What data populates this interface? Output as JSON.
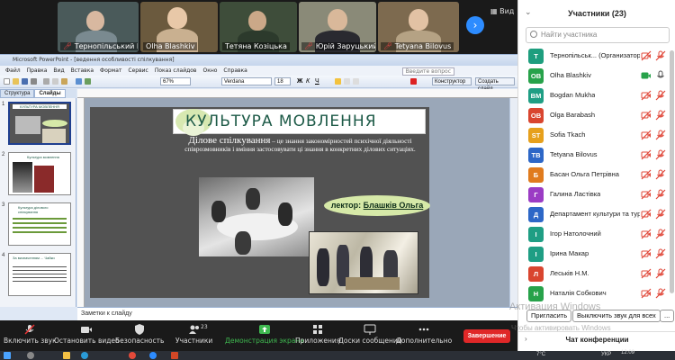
{
  "video_strip": {
    "tiles": [
      {
        "name": "Тернопільський Ц...",
        "bg": "#4a5a5a"
      },
      {
        "name": "Olha Blashkiv",
        "bg": "#6b5a3e"
      },
      {
        "name": "Тетяна Козіцька",
        "bg": "#3e4d3a"
      },
      {
        "name": "Юрій Заруцький",
        "bg": "#8a8a78"
      },
      {
        "name": "Tetyana Bilovus",
        "bg": "#7d6a4f"
      }
    ],
    "view_label": "Вид"
  },
  "ppt": {
    "window_title": "Microsoft PowerPoint - [ведення особливості спілкування]",
    "menu": [
      "Файл",
      "Правка",
      "Вид",
      "Вставка",
      "Формат",
      "Сервис",
      "Показ слайдов",
      "Окно",
      "Справка"
    ],
    "zoom": "67%",
    "font": "Verdana",
    "font_size": "18",
    "search_placeholder": "Введите вопрос",
    "constructor_label": "Конструктор",
    "new_slide_label": "Создать слайд",
    "tabs": [
      "Структура",
      "Слайды"
    ],
    "thumbs": [
      {
        "num": "1",
        "title": "КУЛЬТУРА МОВЛЕННЯ"
      },
      {
        "num": "2",
        "title": "Культура мовлення"
      },
      {
        "num": "3",
        "title": "Культура ділового спілкування"
      },
      {
        "num": "4",
        "title": "За визначенням ... Чайки"
      }
    ],
    "notes_placeholder": "Заметки к слайду"
  },
  "slide": {
    "title": "КУЛЬТУРА МОВЛЕННЯ",
    "body_lead": "Ділове спілкування",
    "body_text": " – це знання закономірностей психічної діяльності співрозмовників і вміння застосовувати ці знання в конкретних ділових ситуаціях.",
    "lector_prefix": "лектор:",
    "lector_name": "Блашків Ольга"
  },
  "panel": {
    "title": "Участники (23)",
    "search_placeholder": "Найти участника",
    "participants": [
      {
        "initials": "Т",
        "name": "Тернопільськ... (Организатор, я)",
        "color": "#1e9e7e",
        "mic": "muted",
        "cam": "off"
      },
      {
        "initials": "OB",
        "name": "Olha Blashkiv",
        "color": "#27a24a",
        "mic": "on",
        "cam": "on"
      },
      {
        "initials": "BM",
        "name": "Bogdan Mukha",
        "color": "#1f9e84",
        "mic": "muted",
        "cam": "off"
      },
      {
        "initials": "OB",
        "name": "Olga Barabash",
        "color": "#d9452f",
        "mic": "muted",
        "cam": "off"
      },
      {
        "initials": "ST",
        "name": "Sofia Tkach",
        "color": "#e6a01c",
        "mic": "muted",
        "cam": "off"
      },
      {
        "initials": "TB",
        "name": "Tetyana Bilovus",
        "color": "#2d67c7",
        "mic": "muted",
        "cam": "offred"
      },
      {
        "initials": "Б",
        "name": "Басан Ольга Петрівна",
        "color": "#e07b1e",
        "mic": "muted",
        "cam": "offred"
      },
      {
        "initials": "Г",
        "name": "Галина Ластівка",
        "color": "#9b3cc4",
        "mic": "muted",
        "cam": "offred"
      },
      {
        "initials": "Д",
        "name": "Департамент культури та тури...",
        "color": "#2d67c7",
        "mic": "muted",
        "cam": "offred"
      },
      {
        "initials": "І",
        "name": "Ігор Натолочний",
        "color": "#1f9e84",
        "mic": "muted",
        "cam": "offred"
      },
      {
        "initials": "І",
        "name": "Ірина Макар",
        "color": "#1f9e84",
        "mic": "muted",
        "cam": "offred"
      },
      {
        "initials": "Л",
        "name": "Леськів Н.М.",
        "color": "#d9452f",
        "mic": "muted",
        "cam": "off"
      },
      {
        "initials": "Н",
        "name": "Наталія Собкович",
        "color": "#27a24a",
        "mic": "muted",
        "cam": "off"
      }
    ],
    "invite_label": "Пригласить",
    "mute_all_label": "Выключить звук для всех",
    "more_label": "...",
    "chat_title": "Чат конференции",
    "watermark": "Активация Windows",
    "watermark_sub": "Чтобы активировать Windows"
  },
  "zoom_toolbar": {
    "buttons": [
      {
        "label": "Включить звук"
      },
      {
        "label": "Остановить видео"
      },
      {
        "label": "Безопасность"
      },
      {
        "label": "Участники",
        "count": "23"
      },
      {
        "label": "Демонстрация экрана"
      },
      {
        "label": "Приложения"
      },
      {
        "label": "Доски сообщений"
      },
      {
        "label": "Дополнительно"
      }
    ],
    "end_label": "Завершение"
  },
  "taskbar": {
    "lang": "УКР",
    "time": "12:09",
    "date": "",
    "temp": "7°C"
  },
  "colors": {
    "accent": "#2d8cff",
    "share_green": "#3fb950",
    "end_red": "#e02828",
    "slide_title": "#1d5a47",
    "lector_bg": "#d6e9a8"
  }
}
